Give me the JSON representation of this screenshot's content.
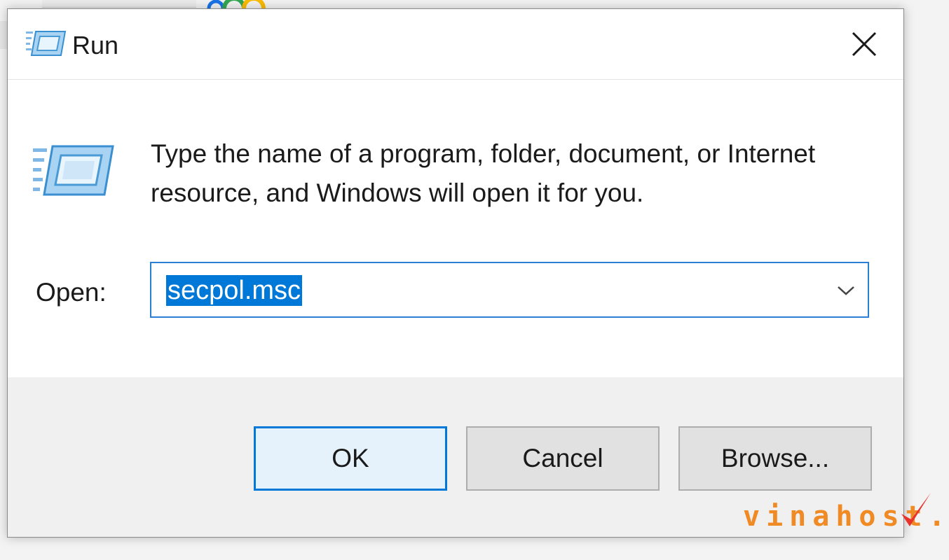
{
  "dialog": {
    "title": "Run",
    "close_icon": "close-icon",
    "app_icon": "run-icon",
    "description": "Type the name of a program, folder, document, or Internet resource, and Windows will open it for you.",
    "open_label": "Open:",
    "open_value": "secpol.msc",
    "dropdown_icon": "chevron-down-icon",
    "buttons": {
      "ok": "OK",
      "cancel": "Cancel",
      "browse": "Browse..."
    }
  },
  "watermark": {
    "text": "vinahost.",
    "check_icon": "check-icon"
  },
  "colors": {
    "accent": "#0078d7",
    "selection": "#0078d7",
    "watermark_orange": "#f08a24",
    "watermark_red": "#e8322c"
  }
}
